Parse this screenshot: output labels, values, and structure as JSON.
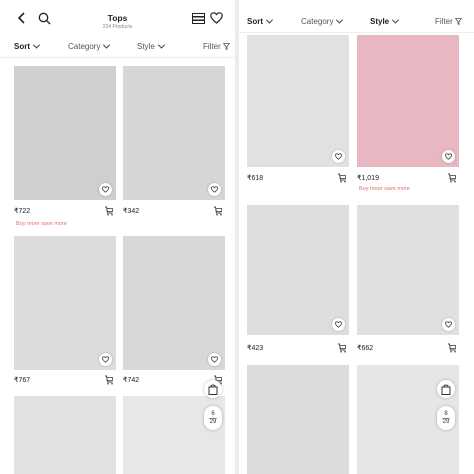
{
  "left": {
    "header": {
      "title": "Tops",
      "subtitle": "234 Products",
      "icons": [
        "back-icon",
        "search-icon",
        "list-view-icon",
        "heart-icon"
      ]
    },
    "filters": {
      "sort": "Sort",
      "category": "Category",
      "style": "Style",
      "filter": "Filter"
    },
    "products": [
      {
        "price": "₹722",
        "promo": "Buy more save more",
        "image": "white-off-shoulder-top-with-shoes"
      },
      {
        "price": "₹342",
        "image": "orange-one-shoulder-crop-top"
      },
      {
        "price": "₹767",
        "image": "white-buttoned-top-denim-shorts"
      },
      {
        "price": "₹742",
        "image": "white-ruffle-sleeve-top"
      },
      {
        "price": "",
        "image": "white-top-partial"
      },
      {
        "price": "",
        "image": "blue-gingham-top-partial"
      }
    ],
    "pager": {
      "current": "6",
      "total": "29"
    }
  },
  "right": {
    "filters": {
      "sort": "Sort",
      "category": "Category",
      "style": "Style",
      "filter": "Filter"
    },
    "products": [
      {
        "price": "₹618",
        "image": "white-polka-dot-ruffle-top"
      },
      {
        "price": "₹1,019",
        "promo": "Buy more save more",
        "image": "black-lace-cami"
      },
      {
        "price": "₹423",
        "image": "metallic-purple-crop-top"
      },
      {
        "price": "₹662",
        "image": "orange-tie-neck-top"
      },
      {
        "price": "",
        "image": "white-cami-partial"
      },
      {
        "price": "",
        "image": "white-peplum-top-partial"
      }
    ],
    "pager": {
      "current": "8",
      "total": "29"
    }
  },
  "colors": {
    "promo": "#e36d6d",
    "text": "#222222",
    "muted": "#888888"
  }
}
